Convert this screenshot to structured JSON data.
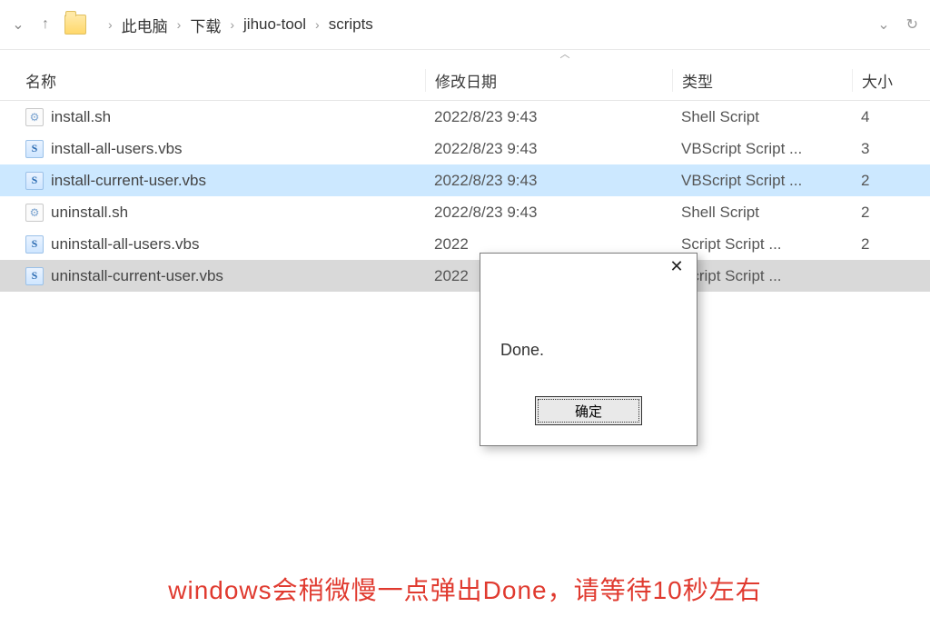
{
  "breadcrumb": [
    "此电脑",
    "下载",
    "jihuo-tool",
    "scripts"
  ],
  "columns": {
    "name": "名称",
    "date": "修改日期",
    "type": "类型",
    "size": "大小"
  },
  "files": [
    {
      "name": "install.sh",
      "date": "2022/8/23 9:43",
      "type": "Shell Script",
      "size": "4",
      "icon": "sh",
      "sel": ""
    },
    {
      "name": "install-all-users.vbs",
      "date": "2022/8/23 9:43",
      "type": "VBScript Script ...",
      "size": "3",
      "icon": "vbs",
      "sel": ""
    },
    {
      "name": "install-current-user.vbs",
      "date": "2022/8/23 9:43",
      "type": "VBScript Script ...",
      "size": "2",
      "icon": "vbs",
      "sel": "blue"
    },
    {
      "name": "uninstall.sh",
      "date": "2022/8/23 9:43",
      "type": "Shell Script",
      "size": "2",
      "icon": "sh",
      "sel": ""
    },
    {
      "name": "uninstall-all-users.vbs",
      "date": "2022",
      "type": "Script Script ...",
      "size": "2",
      "icon": "vbs",
      "sel": ""
    },
    {
      "name": "uninstall-current-user.vbs",
      "date": "2022",
      "type": "Script Script ...",
      "size": "",
      "icon": "vbs",
      "sel": "grey"
    }
  ],
  "dialog": {
    "message": "Done.",
    "ok": "确定"
  },
  "annotation": "windows会稍微慢一点弹出Done，请等待10秒左右"
}
